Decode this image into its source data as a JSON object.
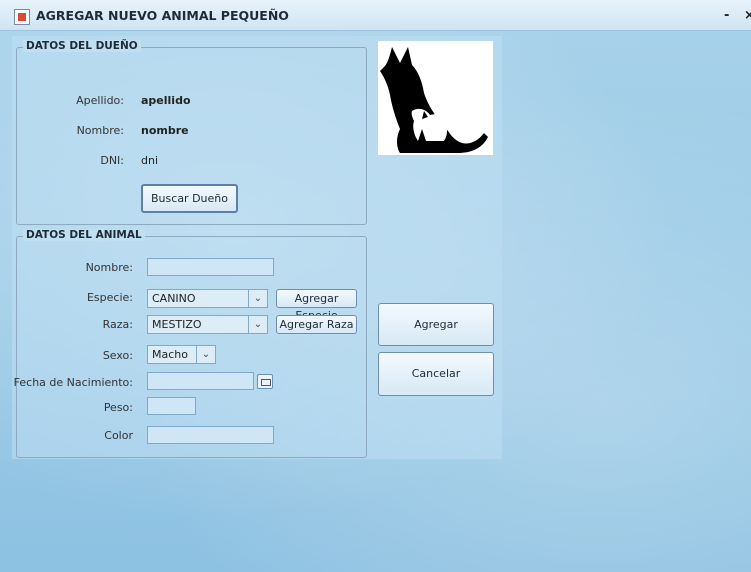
{
  "window": {
    "title": "AGREGAR NUEVO ANIMAL PEQUEÑO",
    "minimize_glyph": "-",
    "close_glyph": "×"
  },
  "owner": {
    "section_title": "DATOS DEL DUEÑO",
    "apellido_label": "Apellido:",
    "apellido_value": "apellido",
    "nombre_label": "Nombre:",
    "nombre_value": "nombre",
    "dni_label": "DNI:",
    "dni_value": "dni",
    "search_button": "Buscar Dueño"
  },
  "animal": {
    "section_title": "DATOS DEL ANIMAL",
    "nombre_label": "Nombre:",
    "nombre_value": "",
    "especie_label": "Especie:",
    "especie_value": "CANINO",
    "add_especie_button": "Agregar Especie",
    "raza_label": "Raza:",
    "raza_value": "MESTIZO",
    "add_raza_button": "Agregar Raza",
    "sexo_label": "Sexo:",
    "sexo_value": "Macho",
    "fecha_label": "Fecha de Nacimiento:",
    "fecha_value": "",
    "peso_label": "Peso:",
    "peso_value": "",
    "color_label": "Color",
    "color_value": ""
  },
  "actions": {
    "add_button": "Agregar",
    "cancel_button": "Cancelar"
  },
  "icons": {
    "app": "java-cup-icon",
    "combo_arrow": "chevron-down-icon",
    "calendar": "calendar-icon",
    "pets_image": "dog-and-cat-silhouette"
  }
}
